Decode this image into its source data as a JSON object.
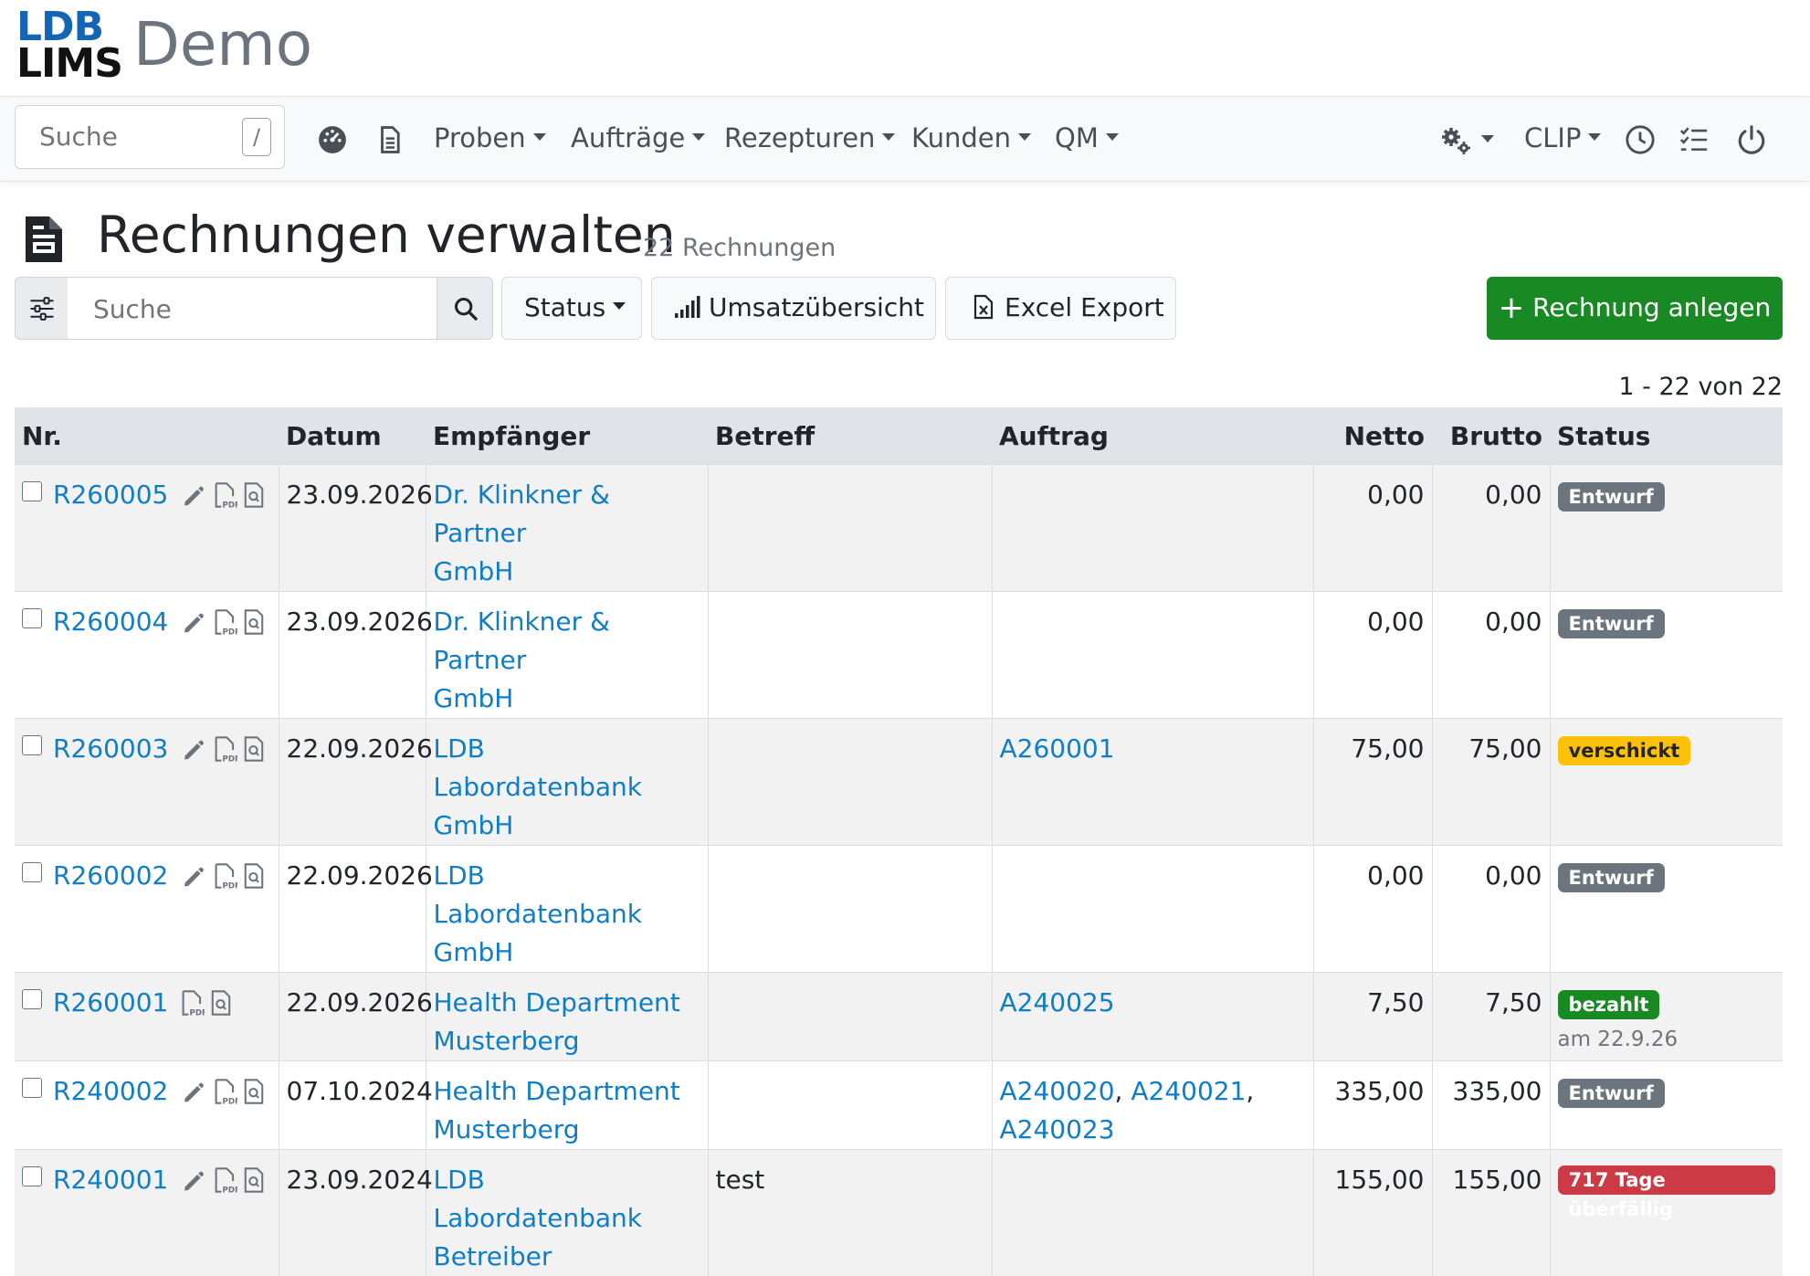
{
  "brand": {
    "logo_line1": "LDB",
    "logo_line2": "LIMS",
    "app_name": "Demo"
  },
  "nav": {
    "search_placeholder": "Suche",
    "search_shortcut": "/",
    "menu": [
      "Proben",
      "Aufträge",
      "Rezepturen",
      "Kunden",
      "QM"
    ],
    "user_menu": "CLIP",
    "icons": [
      "dashboard-icon",
      "document-icon",
      "settings-icon",
      "clock-icon",
      "checklist-icon",
      "power-icon"
    ]
  },
  "page": {
    "title": "Rechnungen verwalten",
    "count": "22 Rechnungen"
  },
  "toolbar": {
    "search_placeholder": "Suche",
    "status_label": "Status",
    "revenue_label": "Umsatzübersicht",
    "export_label": "Excel Export",
    "create_label": "Rechnung anlegen"
  },
  "pagination": "1 - 22 von 22",
  "table": {
    "headers": {
      "nr": "Nr.",
      "datum": "Datum",
      "empfaenger": "Empfänger",
      "betreff": "Betreff",
      "auftrag": "Auftrag",
      "netto": "Netto",
      "brutto": "Brutto",
      "status": "Status"
    },
    "rows": [
      {
        "nr": "R260005",
        "datum": "23.09.2026",
        "empfaenger_1": "Dr. Klinkner & Partner",
        "empfaenger_2": "GmbH",
        "betreff": "",
        "auftrag_1": "",
        "auftrag_2": "",
        "auftrag_3": "",
        "netto": "0,00",
        "brutto": "0,00",
        "status": "Entwurf",
        "status_note": ""
      },
      {
        "nr": "R260004",
        "datum": "23.09.2026",
        "empfaenger_1": "Dr. Klinkner & Partner",
        "empfaenger_2": "GmbH",
        "betreff": "",
        "auftrag_1": "",
        "auftrag_2": "",
        "auftrag_3": "",
        "netto": "0,00",
        "brutto": "0,00",
        "status": "Entwurf",
        "status_note": ""
      },
      {
        "nr": "R260003",
        "datum": "22.09.2026",
        "empfaenger_1": "LDB Labordatenbank",
        "empfaenger_2": "GmbH",
        "betreff": "",
        "auftrag_1": "A260001",
        "auftrag_2": "",
        "auftrag_3": "",
        "netto": "75,00",
        "brutto": "75,00",
        "status": "verschickt",
        "status_note": ""
      },
      {
        "nr": "R260002",
        "datum": "22.09.2026",
        "empfaenger_1": "LDB Labordatenbank",
        "empfaenger_2": "GmbH",
        "betreff": "",
        "auftrag_1": "",
        "auftrag_2": "",
        "auftrag_3": "",
        "netto": "0,00",
        "brutto": "0,00",
        "status": "Entwurf",
        "status_note": ""
      },
      {
        "nr": "R260001",
        "datum": "22.09.2026",
        "empfaenger_1": "Health Department",
        "empfaenger_2": "Musterberg",
        "betreff": "",
        "auftrag_1": "A240025",
        "auftrag_2": "",
        "auftrag_3": "",
        "netto": "7,50",
        "brutto": "7,50",
        "status": "bezahlt",
        "status_note": "am 22.9.26"
      },
      {
        "nr": "R240002",
        "datum": "07.10.2024",
        "empfaenger_1": "Health Department",
        "empfaenger_2": "Musterberg",
        "betreff": "",
        "auftrag_1": "A240020",
        "auftrag_2": "A240021",
        "auftrag_3": "A240023",
        "netto": "335,00",
        "brutto": "335,00",
        "status": "Entwurf",
        "status_note": ""
      },
      {
        "nr": "R240001",
        "datum": "23.09.2024",
        "empfaenger_1": "LDB Labordatenbank",
        "empfaenger_2": "Betreiber",
        "betreff": "test",
        "auftrag_1": "",
        "auftrag_2": "",
        "auftrag_3": "",
        "netto": "155,00",
        "brutto": "155,00",
        "status": "717 Tage überfällig",
        "status_note": ""
      }
    ]
  },
  "colors": {
    "link": "#0f7ec7",
    "brand_blue": "#1565b7",
    "success": "#198a23",
    "draft": "#6c757d",
    "sent": "#ffc107",
    "overdue": "#cc3b45"
  }
}
